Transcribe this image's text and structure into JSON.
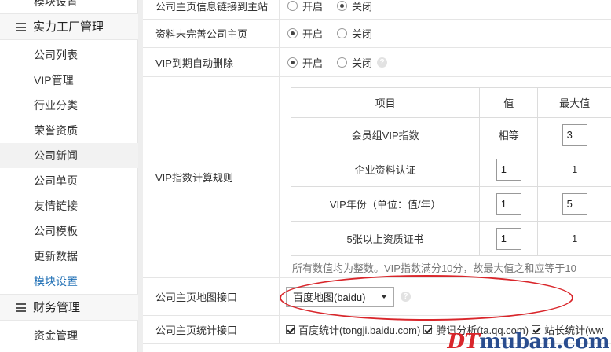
{
  "sidebar": {
    "top_item": "模块设置",
    "group1": "实力工厂管理",
    "items": [
      "公司列表",
      "VIP管理",
      "行业分类",
      "荣誉资质",
      "公司新闻",
      "公司单页",
      "友情链接",
      "公司模板",
      "更新数据",
      "模块设置"
    ],
    "group2": "财务管理",
    "bottom_item": "资金管理"
  },
  "rows": {
    "link_main": {
      "label": "公司主页信息链接到主站",
      "opt_on": "开启",
      "opt_off": "关闭",
      "selected": "关闭"
    },
    "incomplete": {
      "label": "资料未完善公司主页",
      "opt_on": "开启",
      "opt_off": "关闭",
      "selected": "开启"
    },
    "vip_expire": {
      "label": "VIP到期自动删除",
      "opt_on": "开启",
      "opt_off": "关闭",
      "selected": "开启"
    },
    "vip_rule": {
      "label": "VIP指数计算规则"
    },
    "map_api": {
      "label": "公司主页地图接口",
      "select_value": "百度地图(baidu)"
    },
    "stats_api": {
      "label": "公司主页统计接口",
      "options": [
        "百度统计(tongji.baidu.com)",
        "腾讯分析(ta.qq.com)",
        "站长统计(ww"
      ]
    }
  },
  "vip_table": {
    "headers": [
      "项目",
      "值",
      "最大值"
    ],
    "rows": [
      {
        "item": "会员组VIP指数",
        "value": "相等",
        "max": "3"
      },
      {
        "item": "企业资料认证",
        "value": "1",
        "max": "1"
      },
      {
        "item": "VIP年份（单位：值/年）",
        "value": "1",
        "max": "5"
      },
      {
        "item": "5张以上资质证书",
        "value": "1",
        "max": "1"
      }
    ],
    "note": "所有数值均为整数。VIP指数满分10分，故最大值之和应等于10"
  },
  "watermark": {
    "dt": "DT",
    "rest": "muban.com"
  },
  "colors": {
    "active_link": "#1f6fb5",
    "annotation": "#d9262b"
  }
}
